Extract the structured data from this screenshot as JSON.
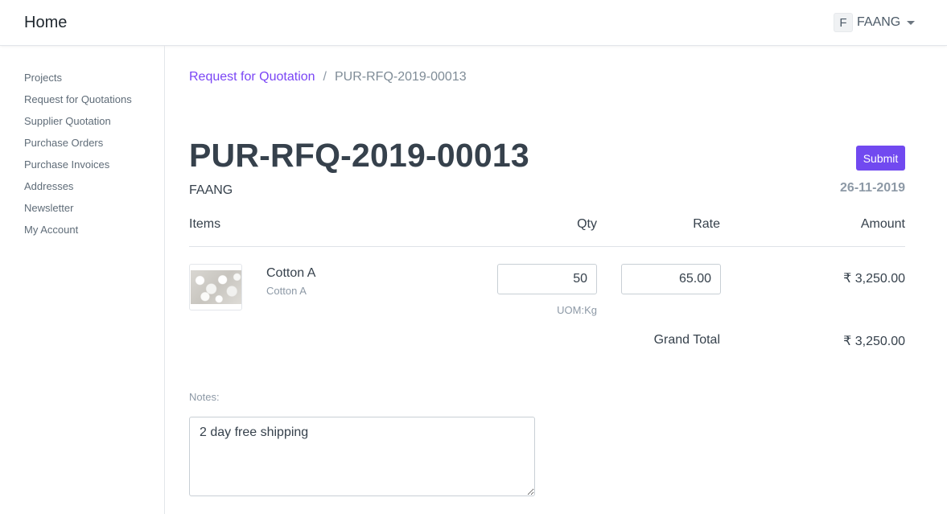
{
  "navbar": {
    "brand": "Home",
    "user": {
      "avatar_letter": "F",
      "name": "FAANG"
    }
  },
  "sidebar": {
    "items": [
      {
        "label": "Projects"
      },
      {
        "label": "Request for Quotations"
      },
      {
        "label": "Supplier Quotation"
      },
      {
        "label": "Purchase Orders"
      },
      {
        "label": "Purchase Invoices"
      },
      {
        "label": "Addresses"
      },
      {
        "label": "Newsletter"
      },
      {
        "label": "My Account"
      }
    ]
  },
  "breadcrumb": {
    "parent": "Request for Quotation",
    "separator": "/",
    "current": "PUR-RFQ-2019-00013"
  },
  "document": {
    "title": "PUR-RFQ-2019-00013",
    "submit_label": "Submit",
    "supplier": "FAANG",
    "date": "26-11-2019"
  },
  "table": {
    "headers": {
      "items": "Items",
      "qty": "Qty",
      "rate": "Rate",
      "amount": "Amount"
    },
    "rows": [
      {
        "item_name": "Cotton A",
        "item_code": "Cotton A",
        "qty": "50",
        "uom": "UOM:Kg",
        "rate": "65.00",
        "amount": "₹ 3,250.00"
      }
    ],
    "grand_total_label": "Grand Total",
    "grand_total_value": "₹ 3,250.00"
  },
  "notes": {
    "label": "Notes:",
    "value": "2 day free shipping"
  },
  "colors": {
    "accent": "#7149f0",
    "link": "#7a45f5",
    "text": "#36414c",
    "muted": "#8d99a6"
  }
}
